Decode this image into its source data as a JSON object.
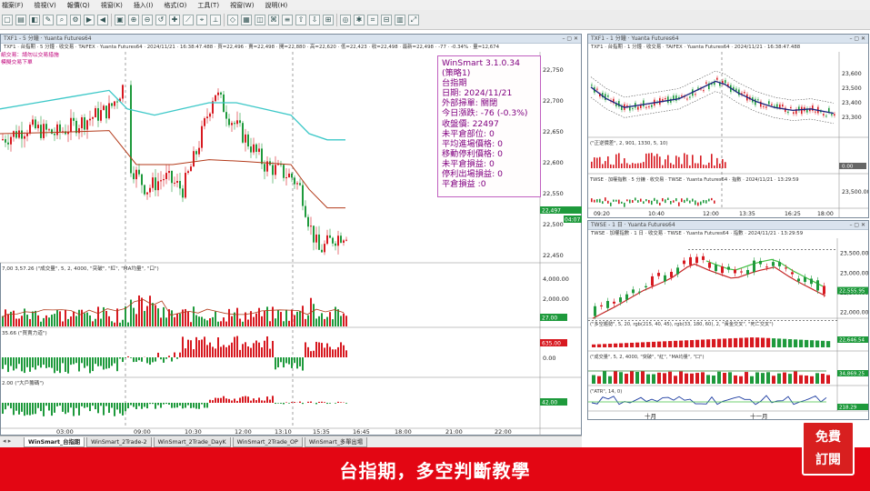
{
  "menu": [
    "檔案(F)",
    "檢視(V)",
    "報價(Q)",
    "視窗(K)",
    "插入(I)",
    "格式(O)",
    "工具(T)",
    "視窗(W)",
    "說明(H)"
  ],
  "main_chart": {
    "title": "TXF1 - 5 分鐘 · Yuanta Futures64",
    "info": "TXF1 · 台指期 · 5 分鐘 · 收交易 · TAIFEX · Yuanta Futures64 · 2024/11/21 · 16:38:47.488 · 買=22,496 · 賣=22,498 · 開=22,880 · 高=22,620 · 低=22,423 · 收=22,498 · 最新=22,498 · -77 · -0.34% · 量=12,674",
    "note1": "紙交易：請勿以交易措施",
    "note2": "模擬交易下單",
    "y_labels": [
      "22,750",
      "22,700",
      "22,650",
      "22,600",
      "22,550",
      "22,500",
      "22,450"
    ],
    "last_price": "22,497",
    "last_time": "04:07"
  },
  "infobox": {
    "lines": [
      "WinSmart 3.1.0.34",
      "(策略1)",
      "台指期",
      "日期: 2024/11/21",
      "外部掃單: 關閉",
      "今日漲跌: -76 (-0.3%)",
      "收盤價: 22497",
      "未平倉部位: 0",
      "平均進場價格: 0",
      "移動停利價格: 0",
      "未平倉損益: 0",
      "停利出場損益: 0",
      "平倉損益 :0"
    ]
  },
  "volume_panel": {
    "label": "(\"成交量\", 5, 2, 4000, \"突破\", \"紅\", \"MA均量\", \"口\")",
    "left_value": "7,00 3,57.26",
    "y_labels": [
      "4,000.00",
      "2,000.00"
    ],
    "tag": "27.00"
  },
  "power_panel": {
    "label": "(\"買賣力道\")",
    "left_value": "35.66",
    "y_labels": [
      "0.00"
    ],
    "tag": "635.00"
  },
  "bull_panel": {
    "label": "(\"大戶籌碼\")",
    "left_value": "2.00",
    "tag": "42.00"
  },
  "time_axis": [
    "03:00",
    "09:00",
    "10:30",
    "12:00",
    "13:10",
    "15:35",
    "16:45",
    "18:00",
    "21:00",
    "22:00"
  ],
  "sheet_tabs": [
    "WinSmart_台指期",
    "WinSmart_2Trade-2",
    "WinSmart_2Trade_DayK",
    "WinSmart_2Trade_OP",
    "WinSmart_多單出場"
  ],
  "right_top": {
    "title": "TXF1 - 1 分鐘 · Yuanta Futures64",
    "info": "TXF1 · 台指期 · 1 分鐘 · 收交易 · TAIFEX · Yuanta Futures64 · 2024/11/21 · 16:38:47.488",
    "y_labels": [
      "23,600",
      "23,500",
      "23,400",
      "23,300"
    ],
    "sub_label": "(\"正逆價差\", 2, 901, 1330, 5, 10)",
    "sub_tag": "0.00",
    "sub2_info": "TWSE · 加權指數 · 5 分鐘 · 收交易 · TWSE · Yuanta Futures64 · 指數 · 2024/11/21 · 13:29:59",
    "sub2_y": [
      "23,500.00"
    ],
    "time_axis": [
      "09:20",
      "10:40",
      "12:00",
      "13:35",
      "16:25",
      "18:00"
    ]
  },
  "right_bottom": {
    "title": "TWSE - 1 日 · Yuanta Futures64",
    "info": "TWSE · 加權指數 · 1 日 · 收交易 · TWSE · Yuanta Futures64 · 指數 · 2024/11/21 · 13:29:59",
    "y_labels": [
      "23,500.00",
      "23,000.00",
      "22,500.00",
      "22,000.00"
    ],
    "price_tag": "22,555.95",
    "p1_label": "(\"多空趨勢\", 5, 20, rgb(215, 40, 45), rgb(33, 180, 60), 2, \"黃金交叉\", \"死亡交叉\")",
    "p1_tag": "22,646.54",
    "p2_label": "(\"成交量\", 5, 2, 4000, \"突破\", \"紅\", \"MA均量\", \"口\")",
    "p2_tag": "34,869.25",
    "p3_label": "(\"ATR\", 14, 0)",
    "p3_tag": "218.29",
    "months": [
      "十月",
      "十一月"
    ]
  },
  "banner": {
    "title": "台指期，多空判斷教學"
  },
  "subscribe": {
    "line1": "免費",
    "line2": "訂閱"
  },
  "colors": {
    "up": "#d71920",
    "down": "#1e9a3c",
    "cyan": "#3cc8c8",
    "ma": "#b33a1a",
    "banner": "#e30613"
  }
}
